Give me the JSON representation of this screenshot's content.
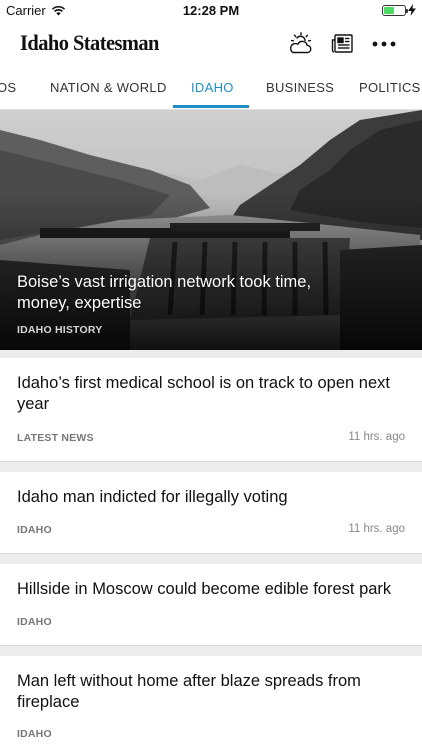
{
  "status_bar": {
    "carrier": "Carrier",
    "time": "12:28 PM",
    "battery_level": 0.5,
    "battery_color": "#4cd964"
  },
  "header": {
    "brand": "Idaho Statesman",
    "icons": [
      "weather-icon",
      "eedition-icon",
      "more-icon"
    ]
  },
  "tabs": {
    "items": [
      "OS",
      "NATION & WORLD",
      "IDAHO",
      "BUSINESS",
      "POLITICS"
    ],
    "active": "IDAHO",
    "accent_color": "#1f8fc3"
  },
  "hero": {
    "title": "Boise’s vast irrigation network took time, money, expertise",
    "category": "IDAHO HISTORY"
  },
  "articles": [
    {
      "title": "Idaho’s first medical school is on track to open next year",
      "category": "LATEST NEWS",
      "time": "11 hrs. ago"
    },
    {
      "title": "Idaho man indicted for illegally voting",
      "category": "IDAHO",
      "time": "11 hrs. ago"
    },
    {
      "title": "Hillside in Moscow could become edible forest park",
      "category": "IDAHO",
      "time": ""
    },
    {
      "title": "Man left without home after blaze spreads from fireplace",
      "category": "IDAHO",
      "time": ""
    }
  ]
}
